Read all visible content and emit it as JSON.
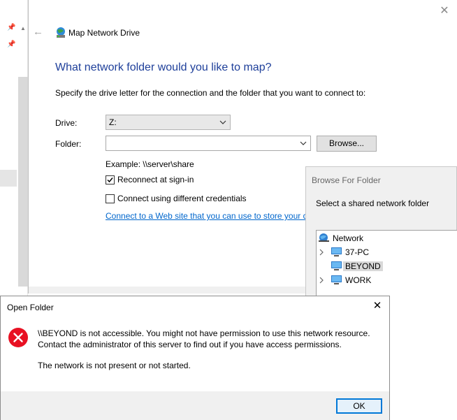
{
  "wizard": {
    "title": "Map Network Drive",
    "heading": "What network folder would you like to map?",
    "instruction": "Specify the drive letter for the connection and the folder that you want to connect to:",
    "drive_label": "Drive:",
    "drive_value": "Z:",
    "folder_label": "Folder:",
    "folder_value": "",
    "browse_label": "Browse...",
    "example": "Example: \\\\server\\share",
    "reconnect_label": "Reconnect at sign-in",
    "reconnect_checked": true,
    "credentials_label": "Connect using different credentials",
    "credentials_checked": false,
    "web_link": "Connect to a Web site that you can use to store your documents and pictures."
  },
  "browse_dialog": {
    "title": "Browse For Folder",
    "prompt": "Select a shared network folder",
    "tree": {
      "root": "Network",
      "items": [
        "37-PC",
        "BEYOND",
        "WORK"
      ],
      "selected": "BEYOND"
    }
  },
  "error_dialog": {
    "title": "Open Folder",
    "message_line1": "\\\\BEYOND is not accessible. You might not have permission to use this network resource.",
    "message_line2": "Contact the administrator of this server to find out if you have access permissions.",
    "message_line3": "The network is not present or not started.",
    "ok_label": "OK"
  },
  "icons": {
    "wizard_title": "network-drive-icon",
    "error": "error-icon",
    "network_root": "network-icon",
    "computer": "computer-icon"
  },
  "colors": {
    "heading": "#1e3f9a",
    "link": "#0066cc",
    "error_red": "#e81123",
    "ok_border": "#0078d7"
  }
}
